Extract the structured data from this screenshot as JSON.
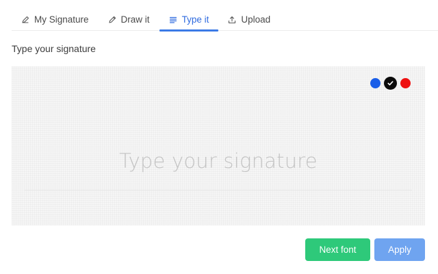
{
  "tabs": [
    {
      "label": "My Signature",
      "icon": "pen-icon",
      "active": false
    },
    {
      "label": "Draw it",
      "icon": "pencil-icon",
      "active": false
    },
    {
      "label": "Type it",
      "icon": "lines-icon",
      "active": true
    },
    {
      "label": "Upload",
      "icon": "upload-icon",
      "active": false
    }
  ],
  "section": {
    "heading": "Type your signature"
  },
  "pad": {
    "input": {
      "value": "",
      "placeholder": "Type your signature"
    },
    "colors": [
      {
        "name": "blue",
        "hex": "#1a5ee8",
        "selected": false
      },
      {
        "name": "black",
        "hex": "#0b0b0b",
        "selected": true
      },
      {
        "name": "red",
        "hex": "#ee1111",
        "selected": false
      }
    ]
  },
  "actions": {
    "next_font_label": "Next font",
    "apply_label": "Apply"
  },
  "theme": {
    "accent": "#2f6bdf",
    "next_button": "#2ec97a",
    "apply_button": "#6fa4f0"
  }
}
